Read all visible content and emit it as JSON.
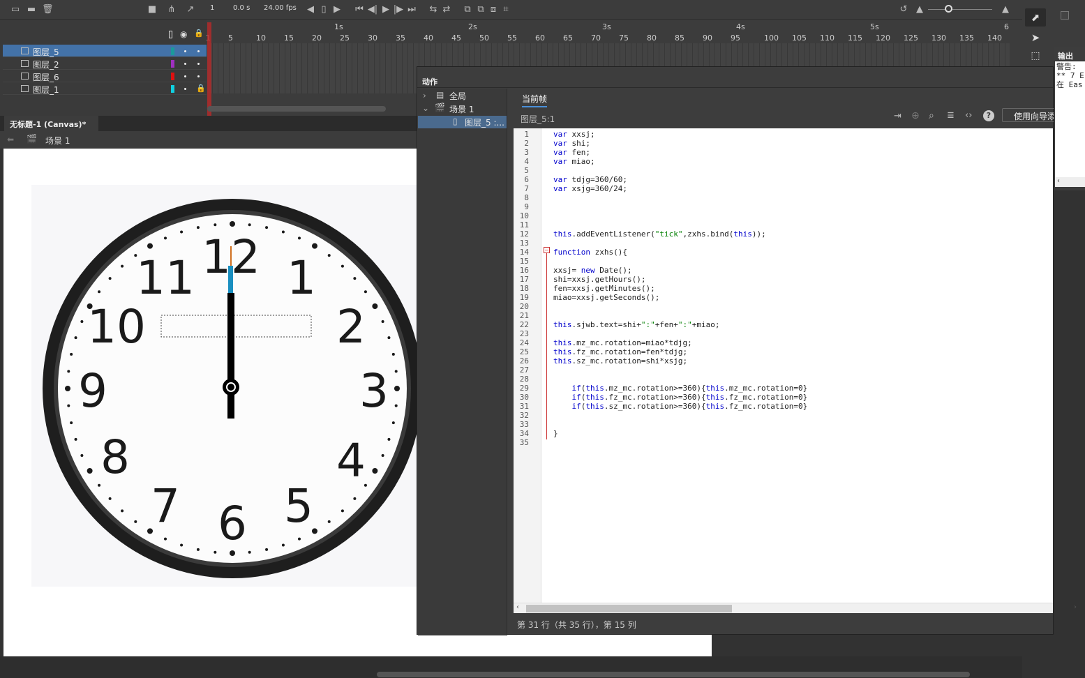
{
  "timeline": {
    "frame_number": "1",
    "time": "0.0 s",
    "fps": "24.00 fps",
    "seconds": [
      "1s",
      "2s",
      "3s",
      "4s",
      "5s",
      "6"
    ],
    "frame_ticks": [
      "1",
      "5",
      "10",
      "15",
      "20",
      "25",
      "30",
      "35",
      "40",
      "45",
      "50",
      "55",
      "60",
      "65",
      "70",
      "75",
      "80",
      "85",
      "90",
      "95",
      "100",
      "105",
      "110",
      "115",
      "120",
      "125",
      "130",
      "135",
      "140"
    ],
    "layers": [
      {
        "name": "图层_5",
        "color": "#1a9a9a",
        "selected": true
      },
      {
        "name": "图层_2",
        "color": "#a030c0",
        "selected": false
      },
      {
        "name": "图层_6",
        "color": "#e01010",
        "selected": false
      },
      {
        "name": "图层_1",
        "color": "#10d0e0",
        "selected": false
      }
    ]
  },
  "document": {
    "tab_label": "无标题-1 (Canvas)*",
    "scene_label": "场景 1"
  },
  "clock": {
    "numbers": [
      "12",
      "1",
      "2",
      "3",
      "4",
      "5",
      "6",
      "7",
      "8",
      "9",
      "10",
      "11"
    ]
  },
  "actions": {
    "panel_title": "动作",
    "tree": {
      "global": "全局",
      "scene": "场景 1",
      "frame": "图层_5 :..."
    },
    "tab_current_frame": "当前帧",
    "frame_label": "图层_5:1",
    "wizard_button": "使用向导添",
    "status": "第 31 行（共 35 行），第 15 列",
    "code_lines": [
      "var xxsj;",
      "var shi;",
      "var fen;",
      "var miao;",
      "",
      "var tdjg=360/60;",
      "var xsjg=360/24;",
      "",
      "",
      "",
      "",
      "this.addEventListener(\"tick\",zxhs.bind(this));",
      "",
      "function zxhs(){",
      "",
      "xxsj= new Date();",
      "shi=xxsj.getHours();",
      "fen=xxsj.getMinutes();",
      "miao=xxsj.getSeconds();",
      "",
      "",
      "this.sjwb.text=shi+\":\"+fen+\":\"+miao;",
      "",
      "this.mz_mc.rotation=miao*tdjg;",
      "this.fz_mc.rotation=fen*tdjg;",
      "this.sz_mc.rotation=shi*xsjg;",
      "",
      "",
      "    if(this.mz_mc.rotation>=360){this.mz_mc.rotation=0}",
      "    if(this.fz_mc.rotation>=360){this.fz_mc.rotation=0}",
      "    if(this.sz_mc.rotation>=360){this.fz_mc.rotation=0}",
      "",
      "",
      "}",
      ""
    ]
  },
  "output": {
    "title": "输出",
    "lines": [
      "警告:",
      "** 7 E",
      "在 Eas"
    ]
  }
}
